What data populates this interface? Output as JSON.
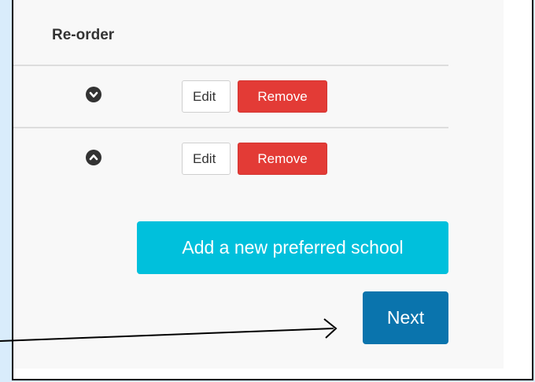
{
  "table": {
    "header_reorder": "Re-order",
    "rows": [
      {
        "order_icon": "chevron-down-icon",
        "edit_label": "Edit",
        "remove_label": "Remove"
      },
      {
        "order_icon": "chevron-up-icon",
        "edit_label": "Edit",
        "remove_label": "Remove"
      }
    ]
  },
  "actions": {
    "add_label": "Add a new preferred school",
    "next_label": "Next"
  },
  "colors": {
    "remove": "#e33b36",
    "add": "#00c0dc",
    "next": "#0a74ad",
    "page_background": "#d9ecfb"
  }
}
